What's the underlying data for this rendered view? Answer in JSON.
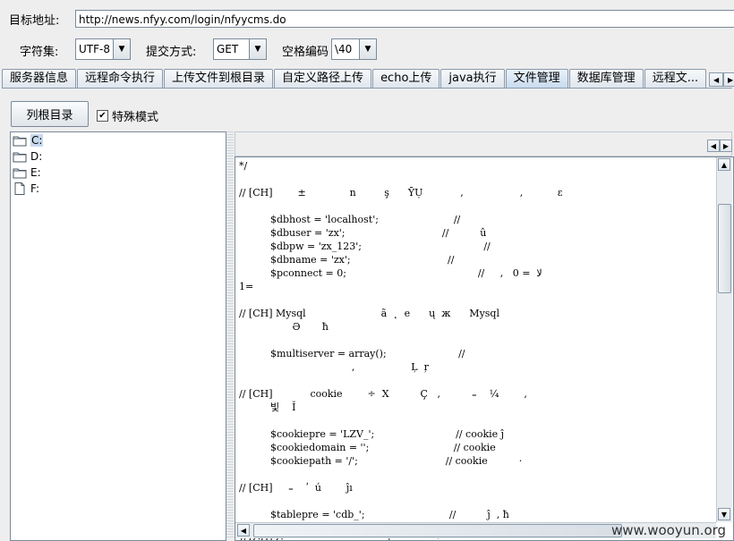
{
  "target": {
    "label": "目标地址:",
    "url": "http://news.nfyy.com/login/nfyycms.do"
  },
  "options": {
    "charset_label": "字符集:",
    "charset_value": "UTF-8",
    "method_label": "提交方式:",
    "method_value": "GET",
    "space_label": "空格编码",
    "space_value": "\\40"
  },
  "tabs": [
    "服务器信息",
    "远程命令执行",
    "上传文件到根目录",
    "自定义路径上传",
    "echo上传",
    "java执行",
    "文件管理",
    "数据库管理",
    "远程文..."
  ],
  "active_tab": "文件管理",
  "toolbar": {
    "list_root_label": "列根目录",
    "special_mode_label": "特殊模式",
    "special_mode_checked": true
  },
  "tree": [
    {
      "label": "C:",
      "icon": "folder-icon",
      "selected": true
    },
    {
      "label": "D:",
      "icon": "folder-icon",
      "selected": false
    },
    {
      "label": "E:",
      "icon": "folder-icon",
      "selected": false
    },
    {
      "label": "F:",
      "icon": "file-icon",
      "selected": false
    }
  ],
  "code_lines": [
    "*/",
    "",
    "// [CH]        ±              n         ş      ῩỤ            ,                  ,           ε",
    "",
    "          $dbhost = 'localhost';                        //",
    "          $dbuser = 'zx';                               //          û",
    "          $dbpw = 'zx_123';                                       //",
    "          $dbname = 'zx';                               //",
    "          $pconnect = 0;                                          //     ,   ﻻ  = 0",
    "1=",
    "",
    "// [CH] Mysql                        ã  ˛  e      ų  ж      Mysql",
    "                 Ә       ħ",
    "",
    "          $multiserver = array();                       //",
    "                                    ,                  Ļ  ŗ",
    "",
    "// [CH]            cookie        ÷  X          Ç   ,          ₌    ¼        ,",
    "          빛    Ĭ",
    "",
    "          $cookiepre = 'LZV_';                          // cookie ĵ",
    "          $cookiedomain = '';                           // cookie",
    "          $cookiepath = '/';                            // cookie          ·",
    "",
    "// [CH]     ₌    ʹ  ú        ĵı",
    "",
    "          $tablepre = 'cdb_';                           //          ĵ  , ħ",
    "",
    "// [CH] C          ˍ              ,      ±              ʹ"
  ],
  "watermark": "www.wooyun.org"
}
